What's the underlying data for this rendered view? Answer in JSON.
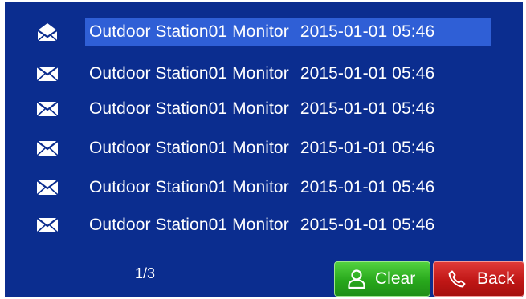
{
  "theme": {
    "background": "#0b2d8f",
    "selected_row": "#2f5fd6",
    "clear_button": "#28a81c",
    "back_button": "#c01716"
  },
  "messages": [
    {
      "source": "Outdoor Station01 Monitor",
      "time": "2015-01-01 05:46",
      "icon": "envelope-open-icon",
      "selected": true
    },
    {
      "source": "Outdoor Station01 Monitor",
      "time": "2015-01-01 05:46",
      "icon": "envelope-icon",
      "selected": false
    },
    {
      "source": "Outdoor Station01 Monitor",
      "time": "2015-01-01 05:46",
      "icon": "envelope-icon",
      "selected": false
    },
    {
      "source": "Outdoor Station01 Monitor",
      "time": "2015-01-01 05:46",
      "icon": "envelope-icon",
      "selected": false
    },
    {
      "source": "Outdoor Station01 Monitor",
      "time": "2015-01-01 05:46",
      "icon": "envelope-icon",
      "selected": false
    },
    {
      "source": "Outdoor Station01 Monitor",
      "time": "2015-01-01 05:46",
      "icon": "envelope-icon",
      "selected": false
    }
  ],
  "pager": {
    "text": "1/3"
  },
  "buttons": {
    "clear": {
      "label": "Clear",
      "icon": "user-icon"
    },
    "back": {
      "label": "Back",
      "icon": "phone-icon"
    }
  }
}
